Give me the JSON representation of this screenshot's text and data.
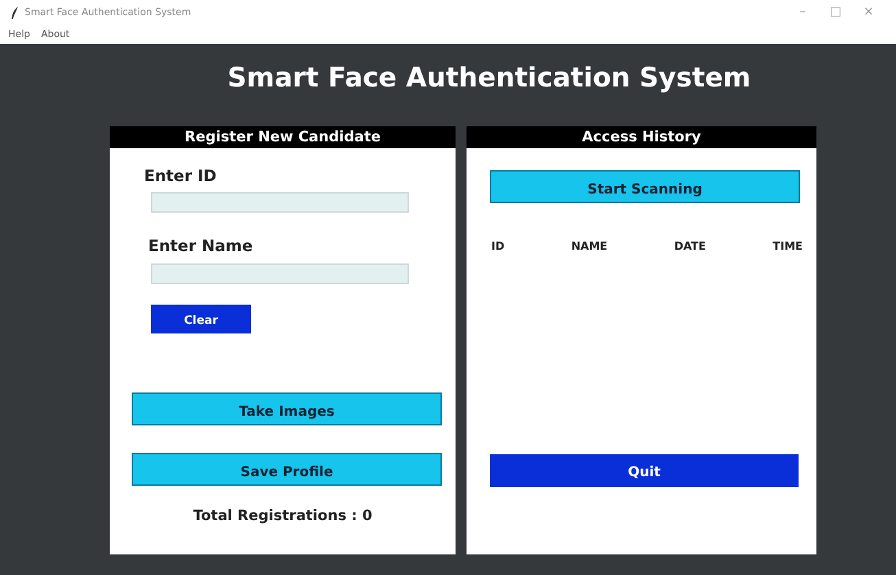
{
  "window": {
    "title": "Smart Face Authentication System",
    "controls": [
      "–",
      "□",
      "×"
    ]
  },
  "menu": [
    "Help",
    "About"
  ],
  "heading": "Smart Face Authentication System",
  "register": {
    "title": "Register New Candidate",
    "fields": [
      {
        "label": "Enter ID"
      },
      {
        "label": "Enter Name"
      }
    ],
    "clear": "Clear",
    "take_images": "Take Images",
    "save_profile": "Save Profile",
    "total": "Total Registrations : 0"
  },
  "history": {
    "title": "Access History",
    "start": "Start Scanning",
    "columns": [
      "ID",
      "NAME",
      "DATE",
      "TIME"
    ],
    "quit": "Quit"
  }
}
